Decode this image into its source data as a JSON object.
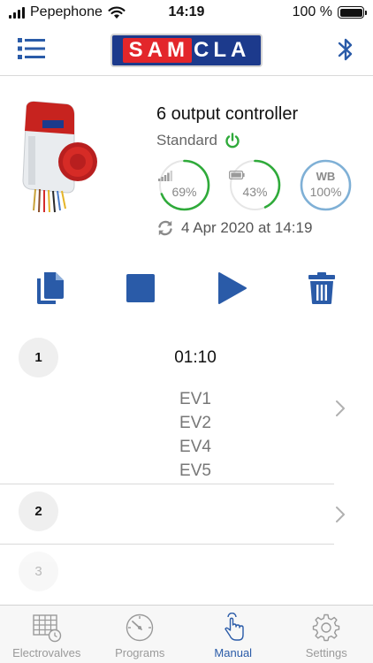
{
  "status_bar": {
    "carrier": "Pepephone",
    "time": "14:19",
    "battery": "100 %"
  },
  "header": {
    "brand_left": "SAM",
    "brand_right": "CLA",
    "menu_icon": "list-icon",
    "bluetooth_icon": "bluetooth-icon"
  },
  "device": {
    "name": "6 output controller",
    "mode": "Standard",
    "power_icon": "power-icon",
    "signal": {
      "value": "69%",
      "level": 0.69,
      "icon": "signal-bars-icon",
      "color": "#2faa3a"
    },
    "battery": {
      "value": "43%",
      "level": 0.43,
      "icon": "battery-icon",
      "color": "#2faa3a"
    },
    "wb": {
      "label": "WB",
      "value": "100%",
      "level": 1.0,
      "color": "#7fb0d6"
    },
    "sync_text": "4 Apr 2020 at 14:19"
  },
  "actions": {
    "copy_icon": "copy-icon",
    "stop_icon": "stop-icon",
    "play_icon": "play-icon",
    "delete_icon": "trash-icon"
  },
  "steps": [
    {
      "number": "1",
      "time": "01:10",
      "valves": [
        "EV1",
        "EV2",
        "EV4",
        "EV5"
      ]
    },
    {
      "number": "2",
      "time": "",
      "valves": []
    },
    {
      "number": "3",
      "time": "",
      "valves": []
    }
  ],
  "tabs": [
    {
      "label": "Electrovalves",
      "icon": "grid-clock-icon",
      "active": false
    },
    {
      "label": "Programs",
      "icon": "gauge-icon",
      "active": false
    },
    {
      "label": "Manual",
      "icon": "hand-tap-icon",
      "active": true
    },
    {
      "label": "Settings",
      "icon": "gear-icon",
      "active": false
    }
  ],
  "colors": {
    "accent": "#2a5ba8",
    "brand_blue": "#1c3a8c",
    "brand_red": "#e3262b",
    "status_green": "#2faa3a"
  }
}
